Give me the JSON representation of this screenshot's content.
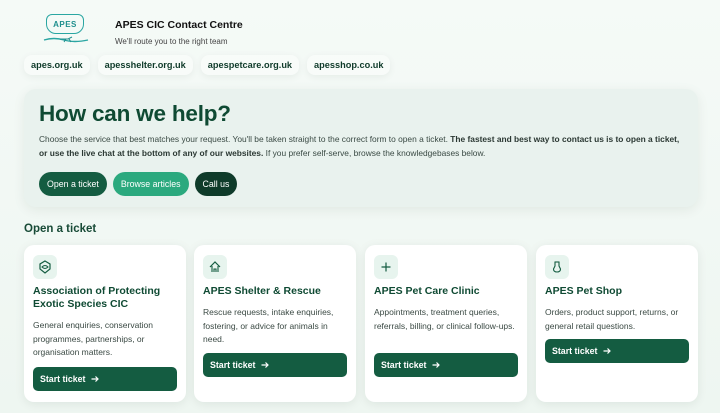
{
  "header": {
    "logo_text": "APES",
    "title": "APES CIC Contact Centre",
    "subtitle": "We'll route you to the right team"
  },
  "sites": [
    {
      "label": "apes.org.uk"
    },
    {
      "label": "apesshelter.org.uk"
    },
    {
      "label": "apespetcare.org.uk"
    },
    {
      "label": "apesshop.co.uk"
    }
  ],
  "hero": {
    "title": "How can we help?",
    "text_1": "Choose the service that best matches your request. You'll be taken straight to the correct form to open a ticket.",
    "text_bold": "The fastest and best way to contact us is to open a ticket, or use the live chat at the bottom of any of our websites.",
    "text_2": "If you prefer self-serve, browse the knowledgebases below.",
    "buttons": [
      {
        "label": "Open a ticket"
      },
      {
        "label": "Browse articles"
      },
      {
        "label": "Call us"
      }
    ]
  },
  "section": {
    "title": "Open a ticket"
  },
  "cards": [
    {
      "icon": "fish-badge-icon",
      "title": "Association of Protecting Exotic Species CIC",
      "desc": "General enquiries, conservation programmes, partnerships, or organisation matters.",
      "button": "Start ticket"
    },
    {
      "icon": "shelter-icon",
      "title": "APES Shelter & Rescue",
      "desc": "Rescue requests, intake enquiries, fostering, or advice for animals in need.",
      "button": "Start ticket"
    },
    {
      "icon": "plus-icon",
      "title": "APES Pet Care Clinic",
      "desc": "Appointments, treatment queries, referrals, billing, or clinical follow-ups.",
      "button": "Start ticket"
    },
    {
      "icon": "bottle-icon",
      "title": "APES Pet Shop",
      "desc": "Orders, product support, returns, or general retail questions.",
      "button": "Start ticket"
    }
  ],
  "colors": {
    "primary": "#145c41",
    "accent": "#2ba97e",
    "dark": "#0f3b2a",
    "heading": "#0f4a33"
  }
}
